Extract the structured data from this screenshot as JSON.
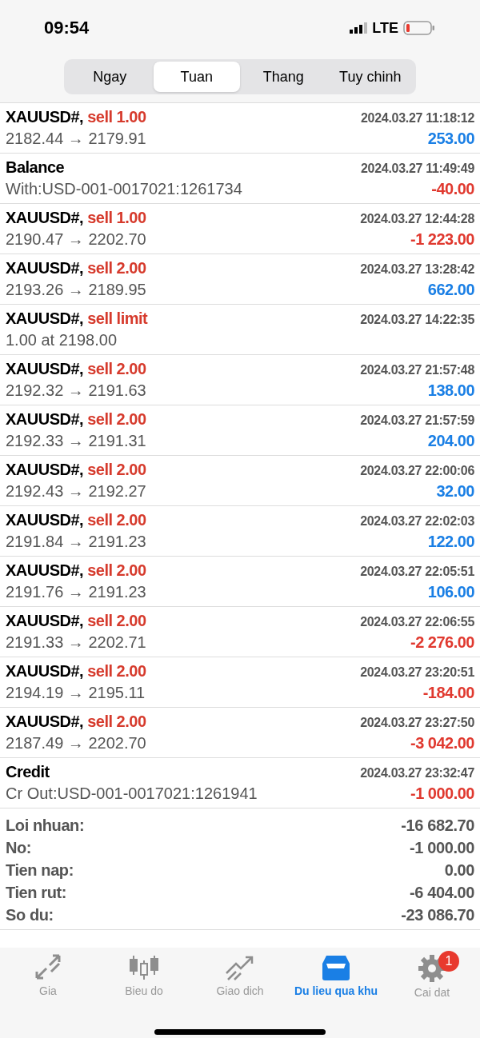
{
  "status_bar": {
    "time": "09:54",
    "network": "LTE"
  },
  "tabs": [
    {
      "label": "Ngay",
      "selected": false
    },
    {
      "label": "Tuan",
      "selected": true
    },
    {
      "label": "Thang",
      "selected": false
    },
    {
      "label": "Tuy chinh",
      "selected": false
    }
  ],
  "rows": [
    {
      "title": "XAUUSD#,",
      "action": "sell 1.00",
      "time": "2024.03.27 11:18:12",
      "detail": "2182.44 → 2179.91",
      "amount": "253.00",
      "color": "#1a7fe5"
    },
    {
      "title": "Balance",
      "time": "2024.03.27 11:49:49",
      "detail": "With:USD-001-0017021:1261734",
      "amount": "-40.00",
      "color": "#e0392f"
    },
    {
      "title": "XAUUSD#,",
      "action": "sell 1.00",
      "time": "2024.03.27 12:44:28",
      "detail": "2190.47 → 2202.70",
      "amount": "-1 223.00",
      "color": "#e0392f"
    },
    {
      "title": "XAUUSD#,",
      "action": "sell 2.00",
      "time": "2024.03.27 13:28:42",
      "detail": "2193.26 → 2189.95",
      "amount": "662.00",
      "color": "#1a7fe5"
    },
    {
      "title": "XAUUSD#,",
      "action": "sell limit",
      "time": "2024.03.27 14:22:35",
      "detail": "1.00 at 2198.00"
    },
    {
      "title": "XAUUSD#,",
      "action": "sell 2.00",
      "time": "2024.03.27 21:57:48",
      "detail": "2192.32 → 2191.63",
      "amount": "138.00",
      "color": "#1a7fe5"
    },
    {
      "title": "XAUUSD#,",
      "action": "sell 2.00",
      "time": "2024.03.27 21:57:59",
      "detail": "2192.33 → 2191.31",
      "amount": "204.00",
      "color": "#1a7fe5"
    },
    {
      "title": "XAUUSD#,",
      "action": "sell 2.00",
      "time": "2024.03.27 22:00:06",
      "detail": "2192.43 → 2192.27",
      "amount": "32.00",
      "color": "#1a7fe5"
    },
    {
      "title": "XAUUSD#,",
      "action": "sell 2.00",
      "time": "2024.03.27 22:02:03",
      "detail": "2191.84 → 2191.23",
      "amount": "122.00",
      "color": "#1a7fe5"
    },
    {
      "title": "XAUUSD#,",
      "action": "sell 2.00",
      "time": "2024.03.27 22:05:51",
      "detail": "2191.76 → 2191.23",
      "amount": "106.00",
      "color": "#1a7fe5"
    },
    {
      "title": "XAUUSD#,",
      "action": "sell 2.00",
      "time": "2024.03.27 22:06:55",
      "detail": "2191.33 → 2202.71",
      "amount": "-2 276.00",
      "color": "#e0392f"
    },
    {
      "title": "XAUUSD#,",
      "action": "sell 2.00",
      "time": "2024.03.27 23:20:51",
      "detail": "2194.19 → 2195.11",
      "amount": "-184.00",
      "color": "#e0392f"
    },
    {
      "title": "XAUUSD#,",
      "action": "sell 2.00",
      "time": "2024.03.27 23:27:50",
      "detail": "2187.49 → 2202.70",
      "amount": "-3 042.00",
      "color": "#e0392f"
    },
    {
      "title": "Credit",
      "time": "2024.03.27 23:32:47",
      "detail": "Cr Out:USD-001-0017021:1261941",
      "amount": "-1 000.00",
      "color": "#e0392f"
    }
  ],
  "summary": [
    {
      "label": "Loi nhuan:",
      "value": "-16 682.70"
    },
    {
      "label": "No:",
      "value": "-1 000.00"
    },
    {
      "label": "Tien nap:",
      "value": "0.00"
    },
    {
      "label": "Tien rut:",
      "value": "-6 404.00"
    },
    {
      "label": "So du:",
      "value": "-23 086.70"
    }
  ],
  "nav": [
    {
      "label": "Gia",
      "kind": "quotes",
      "selected": false
    },
    {
      "label": "Bieu do",
      "kind": "chart",
      "selected": false
    },
    {
      "label": "Giao dich",
      "kind": "trade",
      "selected": false
    },
    {
      "label": "Du lieu qua khu",
      "kind": "history",
      "selected": true
    },
    {
      "label": "Cai dat",
      "kind": "settings",
      "selected": false,
      "badge": "1"
    }
  ]
}
